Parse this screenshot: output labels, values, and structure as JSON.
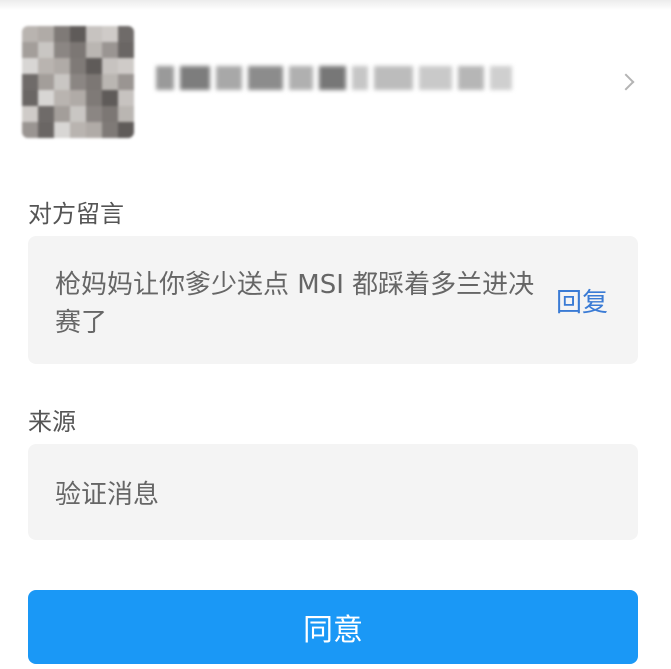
{
  "message_section": {
    "label": "对方留言",
    "text": "枪妈妈让你爹少送点 MSI 都踩着多兰进决赛了",
    "reply_label": "回复"
  },
  "source_section": {
    "label": "来源",
    "value": "验证消息"
  },
  "actions": {
    "agree_label": "同意"
  },
  "colors": {
    "accent": "#1a98f6",
    "link": "#3a7bd5",
    "card_background": "#f4f4f4"
  },
  "icons": {
    "chevron": "chevron-right-icon"
  }
}
